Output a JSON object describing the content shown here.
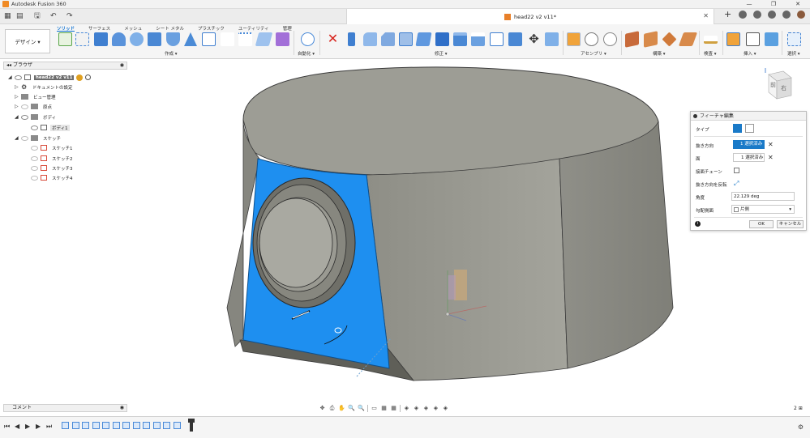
{
  "window": {
    "app_title": "Autodesk Fusion 360",
    "doc_title": "head22 v2 v11*",
    "min": "—",
    "max": "❐",
    "close": "✕"
  },
  "qat": {
    "grid_icon": "▦",
    "file_icon": "▤",
    "save_icon": "🖫",
    "undo_icon": "↶",
    "redo_icon": "↷",
    "doc_close": "✕",
    "plus": "+"
  },
  "ribbon": {
    "workspace": "デザイン ▾",
    "tabs": [
      "ソリッド",
      "サーフェス",
      "メッシュ",
      "シート メタル",
      "プラスチック",
      "ユーティリティ",
      "管理"
    ],
    "active_tab": "ソリッド",
    "groups": [
      "作成 ▾",
      "自動化 ▾",
      "修正 ▾",
      "アセンブリ ▾",
      "構築 ▾",
      "検査 ▾",
      "挿入 ▾",
      "選択 ▾"
    ]
  },
  "browser": {
    "header": "ブラウザ",
    "pin": "◉",
    "items": [
      {
        "label": "head22 v2 v11",
        "level": 0
      },
      {
        "label": "ドキュメントの設定",
        "level": 1
      },
      {
        "label": "ビュー管理",
        "level": 1
      },
      {
        "label": "原点",
        "level": 1
      },
      {
        "label": "ボディ",
        "level": 1
      },
      {
        "label": "ボディ1",
        "level": 2
      },
      {
        "label": "スケッチ",
        "level": 1
      },
      {
        "label": "スケッチ1",
        "level": 2
      },
      {
        "label": "スケッチ2",
        "level": 2
      },
      {
        "label": "スケッチ3",
        "level": 2
      },
      {
        "label": "スケッチ4",
        "level": 2
      }
    ]
  },
  "feature_panel": {
    "title": "フィーチャ編集",
    "type_label": "タイプ",
    "pull_direction_label": "抜き方向",
    "pull_direction_value": "1 選択済み",
    "face_label": "面",
    "face_value": "1 選択済み",
    "tangent_chain_label": "接面チェーン",
    "flip_direction_label": "抜き方向を反転",
    "flip_icon": "⤢",
    "angle_label": "角度",
    "angle_value": "22.129 deg",
    "draft_side_label": "勾配側面",
    "draft_side_value": "片側",
    "ok": "OK",
    "cancel": "キャンセル",
    "info_icon": "i",
    "x": "✕"
  },
  "viewcube": {
    "front": "前",
    "right": "右"
  },
  "bottom": {
    "comments": "コメント",
    "grid_count": "2 ⊞",
    "nav_icons": [
      "✥",
      "⎙",
      "✋",
      "🔍",
      "🔍",
      "▭",
      "▦",
      "▦",
      "◈",
      "◈",
      "◈",
      "◈",
      "◈"
    ]
  },
  "timeline": {
    "controls": [
      "⏮",
      "◀",
      "▶",
      "▶",
      "⏭"
    ],
    "feature_count": 12,
    "gear": "⚙"
  },
  "colors": {
    "accent": "#0a6fd1",
    "selected_face": "#1e8ff0",
    "body_gray": "#9a9a90"
  }
}
